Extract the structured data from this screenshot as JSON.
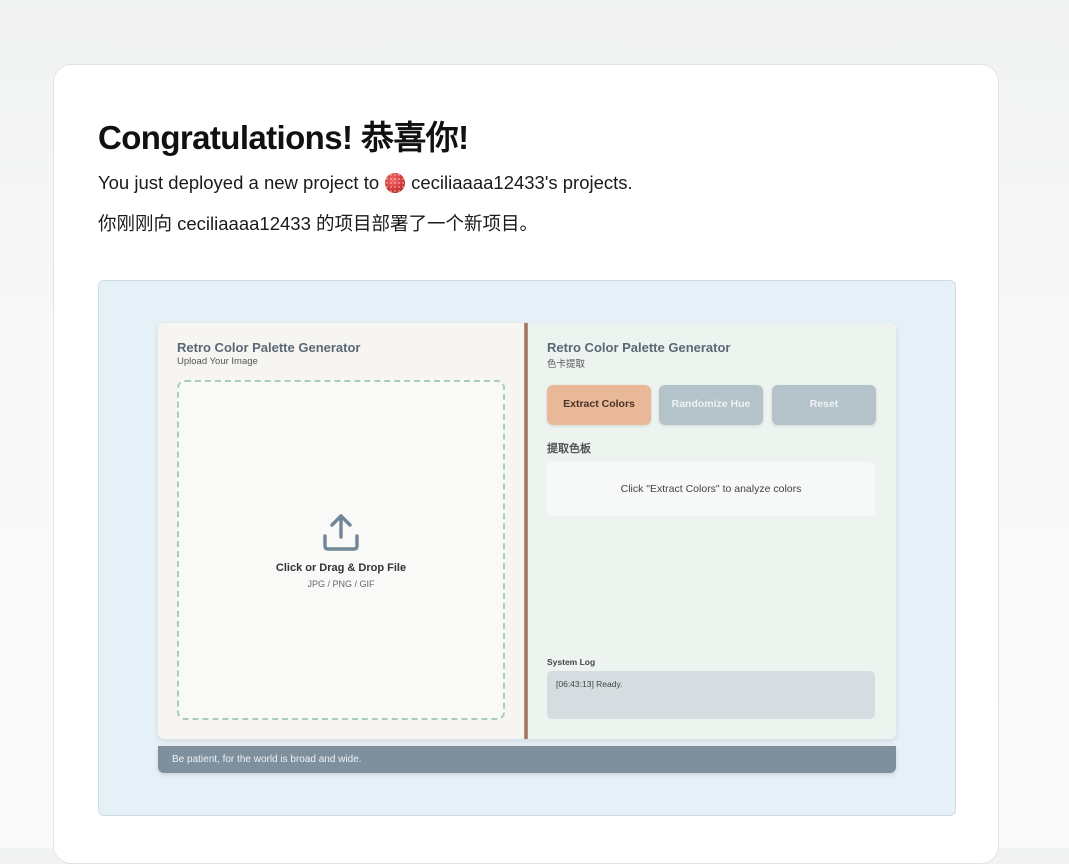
{
  "header": {
    "title": "Congratulations! 恭喜你!",
    "deploy_prefix": "You just deployed a new project to",
    "deploy_owner": "ceciliaaaa12433's projects.",
    "deploy_cn": "你刚刚向 ceciliaaaa12433 的项目部署了一个新项目。"
  },
  "preview_app": {
    "left": {
      "title": "Retro Color Palette Generator",
      "subtitle": "Upload Your Image",
      "dropzone_title": "Click or Drag & Drop File",
      "dropzone_formats": "JPG / PNG / GIF",
      "icon": "upload-icon"
    },
    "right": {
      "title": "Retro Color Palette Generator",
      "subtitle": "色卡提取",
      "buttons": {
        "extract": "Extract Colors",
        "randomize": "Randomize Hue",
        "reset": "Reset"
      },
      "palette_label": "提取色板",
      "palette_placeholder": "Click \"Extract Colors\" to analyze colors",
      "log_label": "System Log",
      "log_text": "[06:43:13] Ready."
    },
    "footer": "Be patient, for the world is broad and wide."
  },
  "colors": {
    "accent_button": "#e9b899",
    "disabled_button": "#b4c2ca",
    "footer_bar": "#7e909e",
    "preview_bg": "#e6f0f7",
    "dropzone_border": "#a9cdb8"
  }
}
